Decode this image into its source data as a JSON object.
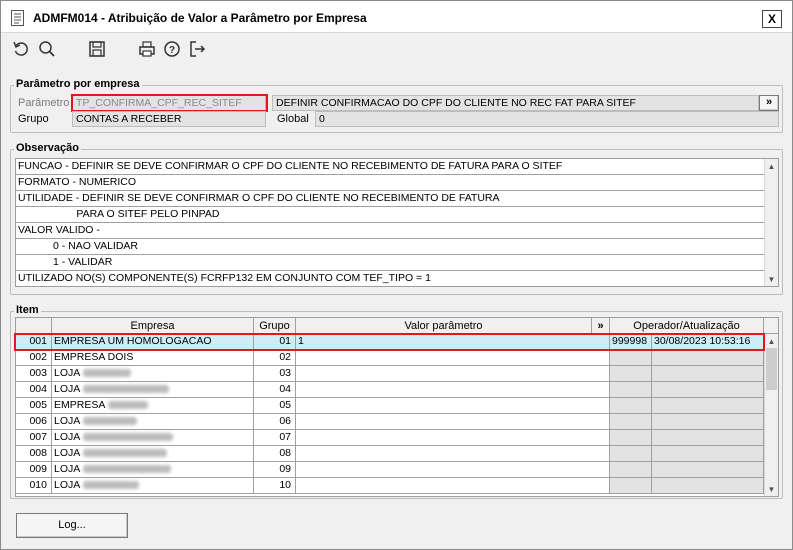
{
  "window": {
    "title": "ADMFM014 - Atribuição de Valor a Parâmetro por Empresa",
    "close_label": "X"
  },
  "toolbar": {
    "icons": [
      "refresh-icon",
      "search-icon",
      "save-icon",
      "print-icon",
      "help-icon",
      "exit-icon"
    ]
  },
  "param": {
    "group_title": "Parâmetro por empresa",
    "parametro_label": "Parâmetro",
    "parametro_value": "TP_CONFIRMA_CPF_REC_SITEF",
    "descricao": "DEFINIR CONFIRMACAO DO CPF DO CLIENTE NO REC FAT PARA SITEF",
    "expand_label": "»",
    "grupo_label": "Grupo",
    "grupo_value": "CONTAS A RECEBER",
    "global_label": "Global",
    "global_value": "0"
  },
  "observacao": {
    "group_title": "Observação",
    "lines": [
      "FUNCAO - DEFINIR SE DEVE CONFIRMAR O CPF DO CLIENTE NO RECEBIMENTO DE FATURA PARA O SITEF",
      "FORMATO - NUMERICO",
      "UTILIDADE - DEFINIR SE DEVE CONFIRMAR O CPF DO CLIENTE NO RECEBIMENTO DE FATURA",
      "                    PARA O SITEF PELO PINPAD",
      "VALOR VALIDO -",
      "            0 - NAO VALIDAR",
      "            1 - VALIDAR",
      "UTILIZADO NO(S) COMPONENTE(S) FCRFP132 EM CONJUNTO COM TEF_TIPO = 1"
    ]
  },
  "item": {
    "group_title": "Item",
    "headers": {
      "empresa": "Empresa",
      "grupo": "Grupo",
      "valor": "Valor parâmetro",
      "expand": "»",
      "operador": "Operador/Atualização"
    },
    "rows": [
      {
        "code": "001",
        "name": "EMPRESA UM HOMOLOGACAO",
        "grupo": "01",
        "valor": "1",
        "operador": "999998",
        "data": "30/08/2023 10:53:16"
      },
      {
        "code": "002",
        "name": "EMPRESA DOIS",
        "grupo": "02",
        "valor": "",
        "operador": "",
        "data": ""
      },
      {
        "code": "003",
        "name": "LOJA",
        "grupo": "03",
        "valor": "",
        "operador": "",
        "data": ""
      },
      {
        "code": "004",
        "name": "LOJA",
        "grupo": "04",
        "valor": "",
        "operador": "",
        "data": ""
      },
      {
        "code": "005",
        "name": "EMPRESA",
        "grupo": "05",
        "valor": "",
        "operador": "",
        "data": ""
      },
      {
        "code": "006",
        "name": "LOJA",
        "grupo": "06",
        "valor": "",
        "operador": "",
        "data": ""
      },
      {
        "code": "007",
        "name": "LOJA",
        "grupo": "07",
        "valor": "",
        "operador": "",
        "data": ""
      },
      {
        "code": "008",
        "name": "LOJA",
        "grupo": "08",
        "valor": "",
        "operador": "",
        "data": ""
      },
      {
        "code": "009",
        "name": "LOJA",
        "grupo": "09",
        "valor": "",
        "operador": "",
        "data": ""
      },
      {
        "code": "010",
        "name": "LOJA",
        "grupo": "10",
        "valor": "",
        "operador": "",
        "data": ""
      }
    ]
  },
  "footer": {
    "log_label": "Log..."
  },
  "colors": {
    "selected_row": "#cdeef5",
    "highlight_border": "#e0191e",
    "readonly_field": "#e3e3e3"
  }
}
